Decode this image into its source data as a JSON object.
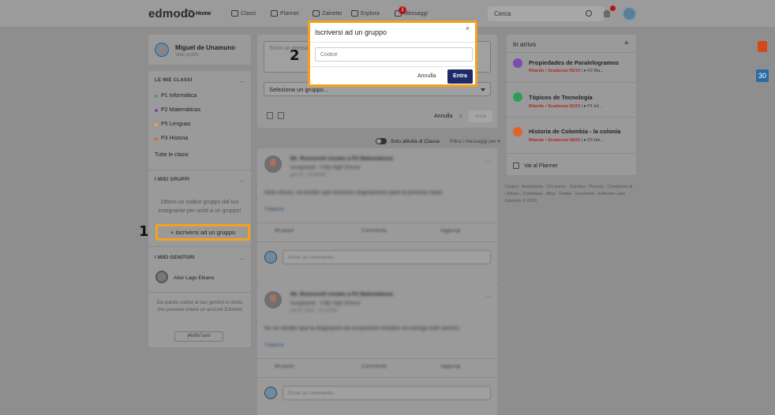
{
  "nav": {
    "brand": "edmodo",
    "home": "Home",
    "classi": "Classi",
    "planner": "Planner",
    "zainetto": "Zainetto",
    "esplora": "Esplora",
    "messaggi": "Messaggi",
    "messages_badge": "1",
    "search_placeholder": "Cerca"
  },
  "profile": {
    "name": "Miguel de Unamuno",
    "sub": "Vedi profilo"
  },
  "classes": {
    "title": "LE MIE CLASSI",
    "items": [
      {
        "label": "P1 Informática",
        "color": "#3aa55a"
      },
      {
        "label": "P2 Matemáticas",
        "color": "#8a3fb0"
      },
      {
        "label": "P5 Lenguas",
        "color": "#f0a52a"
      },
      {
        "label": "P3 Historia",
        "color": "#e0632c"
      }
    ],
    "all": "Tutte le classi"
  },
  "groups": {
    "title": "I MIEI GRUPPI",
    "hint": "Ottieni un codice gruppo dal tuo insegnante per unirti a un gruppo!",
    "join_button": "+ Iscriversi ad un gruppo"
  },
  "parents": {
    "title": "I MIEI GENITORI",
    "parent_name": "Aitor Lago Elkano",
    "hint": "Dà questo codice ai tuoi genitori in modo che possano creare un account Edmodo",
    "code": "j4b8fe7ami"
  },
  "composer": {
    "placeholder": "Scrivi un messaggio",
    "select_label": "Seleziona un gruppo...",
    "cancel": "Annulla",
    "count": "0",
    "send": "Invia"
  },
  "filter": {
    "toggle_label": "Solo attività di Classe",
    "filter_label": "Filtra i messaggi per ▾"
  },
  "posts": [
    {
      "author": "Mr. Roosevelt inviato a P2 Matemáticas",
      "meta": "Insegnante · il My High School",
      "time": "gen 31 · 11:45 AM · ",
      "body": "Hola chicos, recuerden que tenemos asignaciones para la próxima clase",
      "translate": "Tradurre",
      "actions": [
        "Mi piace",
        "Commenta",
        "Aggiungi"
      ],
      "comment_placeholder": "Scrivi un commento..."
    },
    {
      "author": "Mr. Roosevelt inviato a P2 Matemáticas",
      "meta": "Insegnante · il My High School",
      "time": "set 25, 2019 · 12:14 PM · ",
      "body": "No se olviden que la Asignación de ecuaciones lineales se entrega este viernes.",
      "translate": "Tradurre",
      "actions": [
        "Mi piace",
        "Commenta",
        "Aggiungi"
      ],
      "comment_placeholder": "Scrivi un commento..."
    }
  ],
  "inbox": {
    "title": "In arrivo",
    "plus": "+",
    "tasks": [
      {
        "name": "Propiedades de Paralelogramos",
        "status": "Ritardo • Scadenza 05/10",
        "class": "P2 Ma...",
        "icon_color": "#7a4bb0",
        "class_color": "#8a3fb0"
      },
      {
        "name": "Tópicos de Tecnología",
        "status": "Ritardo • Scadenza 05/23",
        "class": "P1 Inf...",
        "icon_color": "#2e9b59",
        "class_color": "#3aa55a"
      },
      {
        "name": "Historia de Colombia - la colonia",
        "status": "Ritardo • Scadenza 08/20",
        "class": "P3 His...",
        "icon_color": "#e0632c",
        "class_color": "#e0632c"
      }
    ],
    "planner_link": "Vai al Planner"
  },
  "footer": {
    "text": "Lingue · Assistenza · Chi siamo · Carriere · Privacy · Condizioni di Utilizzo · Contattaci · Blog · Twitter · Facebook · Edmodo Labs",
    "copyright": "Edmodo © 2020"
  },
  "calendar_day": "30",
  "modal": {
    "title": "Iscriversi ad un gruppo",
    "close": "×",
    "code_placeholder": "Codice",
    "cancel": "Annulla",
    "enter": "Entra"
  },
  "steps": [
    "1",
    "2"
  ]
}
